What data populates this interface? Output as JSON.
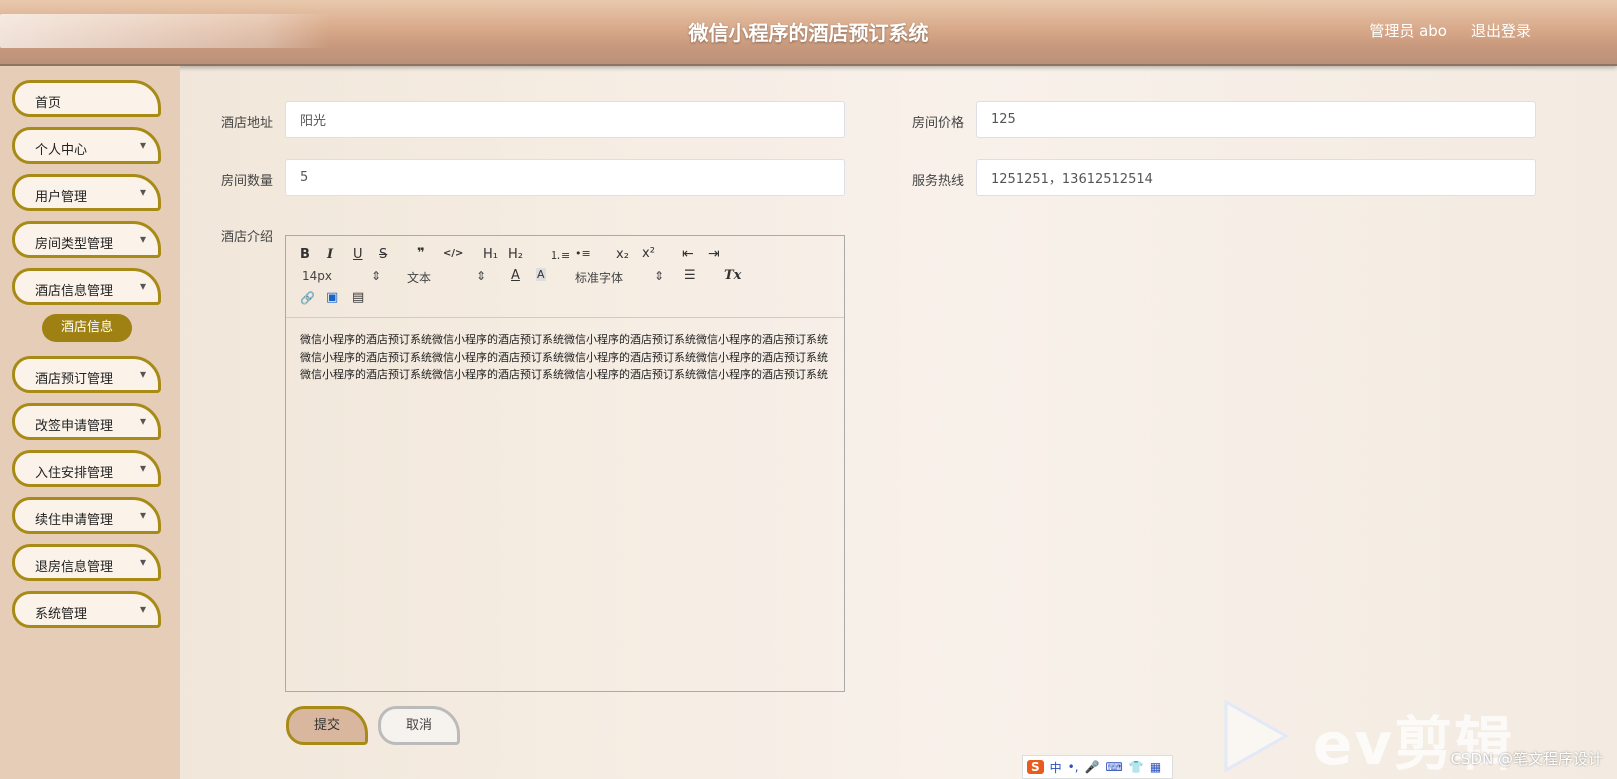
{
  "header": {
    "title": "微信小程序的酒店预订系统",
    "user": "管理员 abo",
    "logout": "退出登录"
  },
  "sidebar": {
    "items": [
      {
        "label": "首页",
        "expandable": false
      },
      {
        "label": "个人中心",
        "expandable": true
      },
      {
        "label": "用户管理",
        "expandable": true
      },
      {
        "label": "房间类型管理",
        "expandable": true
      },
      {
        "label": "酒店信息管理",
        "expandable": true
      },
      {
        "label": "酒店预订管理",
        "expandable": true
      },
      {
        "label": "改签申请管理",
        "expandable": true
      },
      {
        "label": "入住安排管理",
        "expandable": true
      },
      {
        "label": "续住申请管理",
        "expandable": true
      },
      {
        "label": "退房信息管理",
        "expandable": true
      },
      {
        "label": "系统管理",
        "expandable": true
      }
    ],
    "active_submenu": "酒店信息",
    "chevron": "▾"
  },
  "form": {
    "address": {
      "label": "酒店地址",
      "value": "阳光"
    },
    "price": {
      "label": "房间价格",
      "value": "125"
    },
    "count": {
      "label": "房间数量",
      "value": "5"
    },
    "hotline": {
      "label": "服务热线",
      "value": "1251251，13612512514"
    },
    "intro": {
      "label": "酒店介绍",
      "content": "微信小程序的酒店预订系统微信小程序的酒店预订系统微信小程序的酒店预订系统微信小程序的酒店预订系统微信小程序的酒店预订系统微信小程序的酒店预订系统微信小程序的酒店预订系统微信小程序的酒店预订系统微信小程序的酒店预订系统微信小程序的酒店预订系统微信小程序的酒店预订系统微信小程序的酒店预订系统"
    }
  },
  "editor_toolbar": {
    "bold": "B",
    "italic": "I",
    "underline": "U",
    "strike": "S",
    "quote": "❞",
    "code": "</>",
    "h1": "H₁",
    "h2": "H₂",
    "ordered_list": "⒈≡",
    "bullet_list": "•≡",
    "subscript": "x₂",
    "superscript": "x²",
    "outdent": "⇤",
    "indent": "⇥",
    "font_size": "14px",
    "text_type": "文本",
    "font_family": "标准字体",
    "font_color": "A",
    "bg_color": "A",
    "align": "☰",
    "clear_format": "Tx",
    "select_arrow": "⇕",
    "link": "🔗",
    "image": "▣",
    "video": "▤"
  },
  "buttons": {
    "submit": "提交",
    "cancel": "取消"
  },
  "overlays": {
    "watermark": "ev剪辑",
    "csdn": "CSDN @笔文程序设计",
    "ime": [
      "S",
      "中",
      "•,",
      "🎤",
      "⌨",
      "👕",
      "▦"
    ]
  }
}
